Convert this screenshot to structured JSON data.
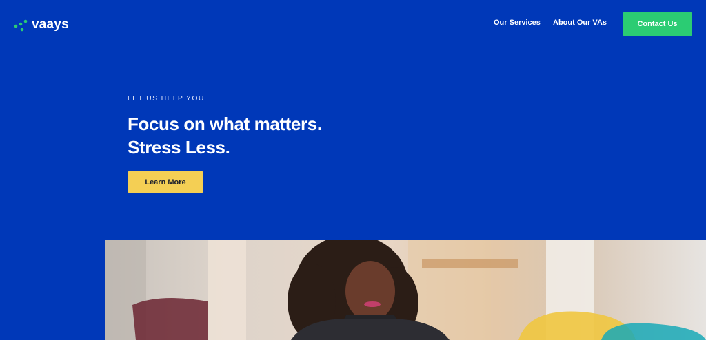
{
  "brand": {
    "name": "vaays"
  },
  "nav": {
    "links": [
      {
        "label": "Our Services"
      },
      {
        "label": "About Our VAs"
      }
    ],
    "cta_label": "Contact Us"
  },
  "hero": {
    "eyebrow": "LET US HELP YOU",
    "headline_line1": "Focus on what matters.",
    "headline_line2": "Stress Less.",
    "button_label": "Learn More"
  },
  "colors": {
    "background": "#0038b8",
    "cta": "#2bcc73",
    "button": "#f4cf54",
    "logo_dots": "#2bcc73"
  },
  "icons": [
    "logo-dots-icon"
  ]
}
